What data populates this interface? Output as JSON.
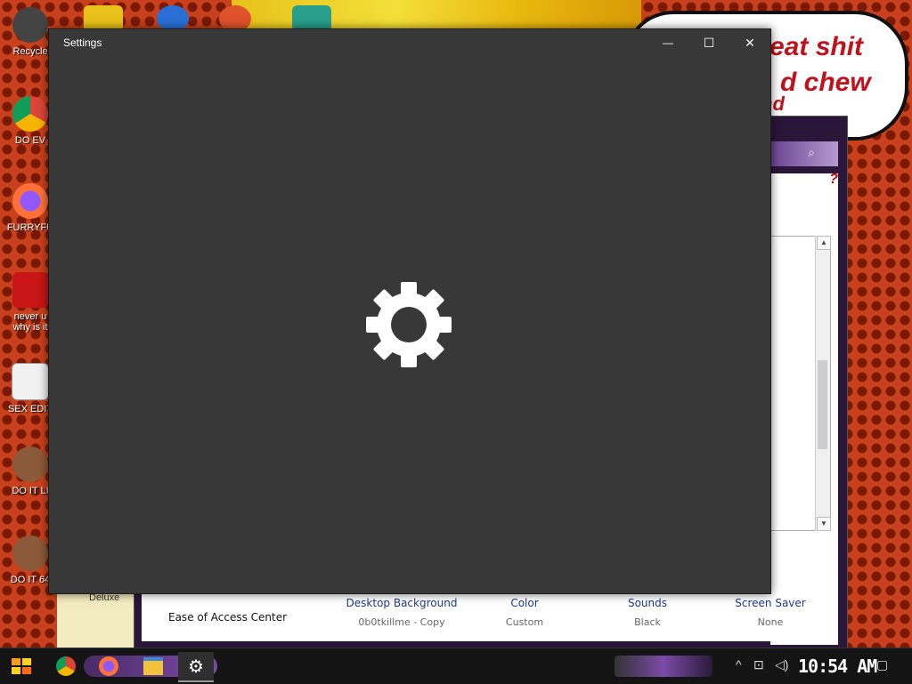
{
  "desktop": {
    "icons": [
      {
        "label": "Recycle",
        "color": "#3a3a3a"
      },
      {
        "label": "DO EV",
        "color": "#1a73e8"
      },
      {
        "label": "FURRYFU",
        "color": "#ff7139"
      },
      {
        "label": "never u",
        "sublabel": "why is it",
        "color": "#c91515"
      },
      {
        "label": "SEX EDIT",
        "color": "#f0f0f0"
      },
      {
        "label": "DO IT LI",
        "color": "#8a5a3a"
      },
      {
        "label": "DO IT 64",
        "color": "#8a5a3a"
      }
    ],
    "speech_bubble": {
      "line1": "eat shit",
      "line2": "d chew",
      "line3": "nd"
    },
    "partial_label": "Deluxe"
  },
  "control_panel": {
    "items": [
      {
        "name": "Desktop Background",
        "sub": "0b0tkillme - Copy"
      },
      {
        "name": "Color",
        "sub": "Custom"
      },
      {
        "name": "Sounds",
        "sub": "Black"
      },
      {
        "name": "Screen Saver",
        "sub": "None"
      }
    ],
    "ease_of_access": "Ease of Access Center",
    "help_icon": "?"
  },
  "settings_window": {
    "title": "Settings",
    "minimize_icon": "—",
    "maximize_icon": "☐",
    "close_icon": "✕"
  },
  "taskbar": {
    "clock": "10:54 AM",
    "apps": [
      "start",
      "chrome",
      "firefox",
      "file-explorer",
      "settings"
    ]
  },
  "colors": {
    "settings_bg": "#383838",
    "accent_purple": "#7b4aa6",
    "wallpaper_red": "#c8411c"
  }
}
